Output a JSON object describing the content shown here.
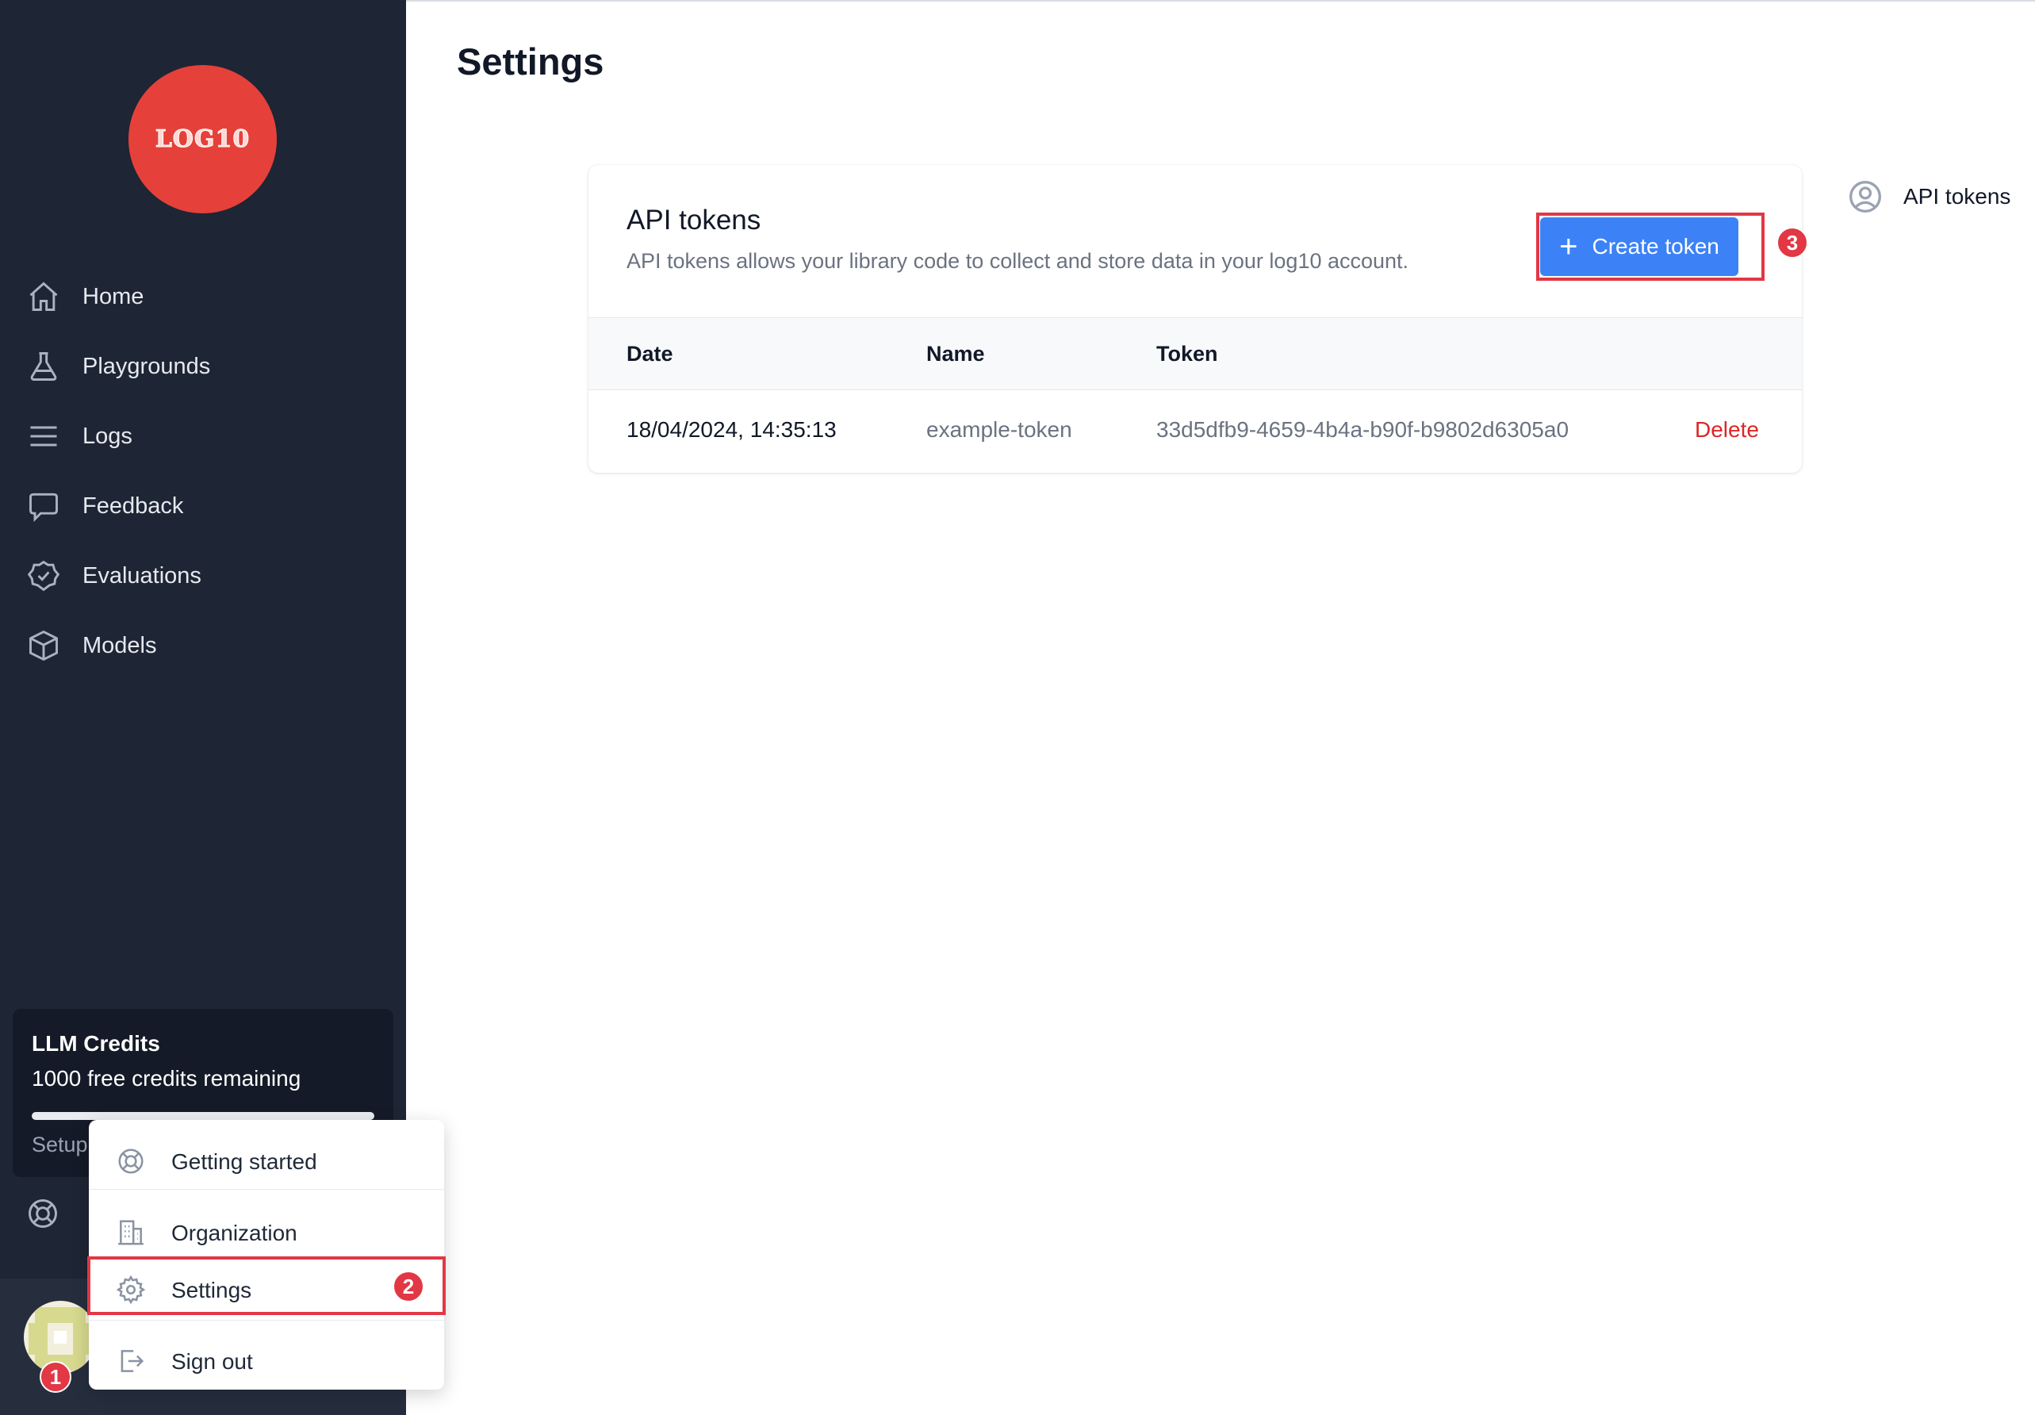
{
  "sidebar": {
    "logo_text": "LOG10",
    "items": [
      {
        "label": "Home",
        "icon": "home-icon"
      },
      {
        "label": "Playgrounds",
        "icon": "flask-icon"
      },
      {
        "label": "Logs",
        "icon": "list-icon"
      },
      {
        "label": "Feedback",
        "icon": "chat-bubble-icon"
      },
      {
        "label": "Evaluations",
        "icon": "check-badge-icon"
      },
      {
        "label": "Models",
        "icon": "cube-icon"
      }
    ],
    "credits": {
      "title": "LLM Credits",
      "remaining": "1000 free credits remaining",
      "progress_fraction": 1.0,
      "setup_label": "Setup"
    }
  },
  "user_menu": {
    "items": [
      {
        "label": "Getting started",
        "icon": "lifebuoy-icon"
      },
      {
        "label": "Organization",
        "icon": "building-icon"
      },
      {
        "label": "Settings",
        "icon": "gear-icon"
      },
      {
        "label": "Sign out",
        "icon": "sign-out-icon"
      }
    ]
  },
  "annotations": {
    "step1": "1",
    "step2": "2",
    "step3": "3",
    "highlight_color": "#e23744"
  },
  "page": {
    "title": "Settings"
  },
  "api_tokens": {
    "title": "API tokens",
    "description": "API tokens allows your library code to collect and store data in your log10 account.",
    "create_button": "Create token",
    "columns": [
      "Date",
      "Name",
      "Token"
    ],
    "rows": [
      {
        "date": "18/04/2024, 14:35:13",
        "name": "example-token",
        "token": "33d5dfb9-4659-4b4a-b90f-b9802d6305a0",
        "action": "Delete"
      }
    ]
  },
  "right_nav": {
    "label": "API tokens",
    "icon": "user-circle-icon"
  },
  "colors": {
    "sidebar_bg": "#1e2534",
    "logo_bg": "#e5413a",
    "primary": "#3c82f6",
    "danger": "#dc2626"
  }
}
